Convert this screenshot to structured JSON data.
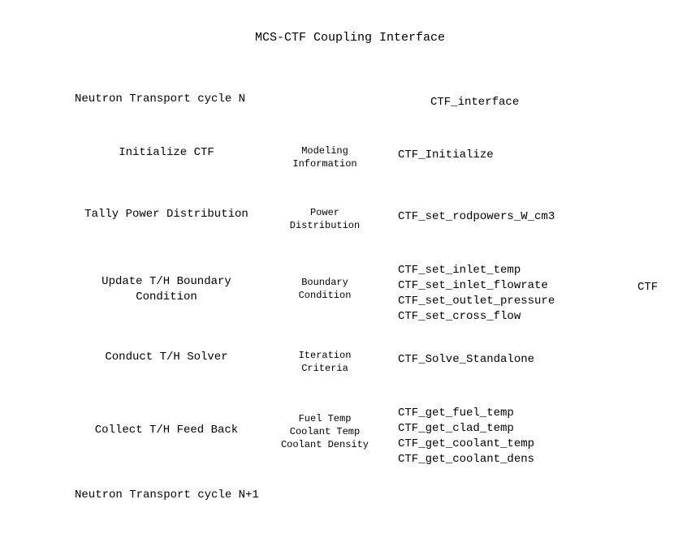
{
  "title": "MCS-CTF Coupling Interface",
  "left_header": "Neutron Transport cycle N",
  "right_header": "CTF_interface",
  "far_label": "CTF",
  "left_footer": "Neutron Transport cycle N+1",
  "rows": [
    {
      "left": "Initialize CTF",
      "mid": "Modeling\nInformation",
      "right": "CTF_Initialize"
    },
    {
      "left": "Tally Power Distribution",
      "mid": "Power\nDistribution",
      "right": "CTF_set_rodpowers_W_cm3"
    },
    {
      "left": "Update T/H Boundary\nCondition",
      "mid": "Boundary\nCondition",
      "right": "CTF_set_inlet_temp\nCTF_set_inlet_flowrate\nCTF_set_outlet_pressure\nCTF_set_cross_flow"
    },
    {
      "left": "Conduct T/H Solver",
      "mid": "Iteration\nCriteria",
      "right": "CTF_Solve_Standalone"
    },
    {
      "left": "Collect T/H Feed Back",
      "mid": "Fuel Temp\nCoolant Temp\nCoolant Density",
      "right": "CTF_get_fuel_temp\nCTF_get_clad_temp\nCTF_get_coolant_temp\nCTF_get_coolant_dens"
    }
  ]
}
